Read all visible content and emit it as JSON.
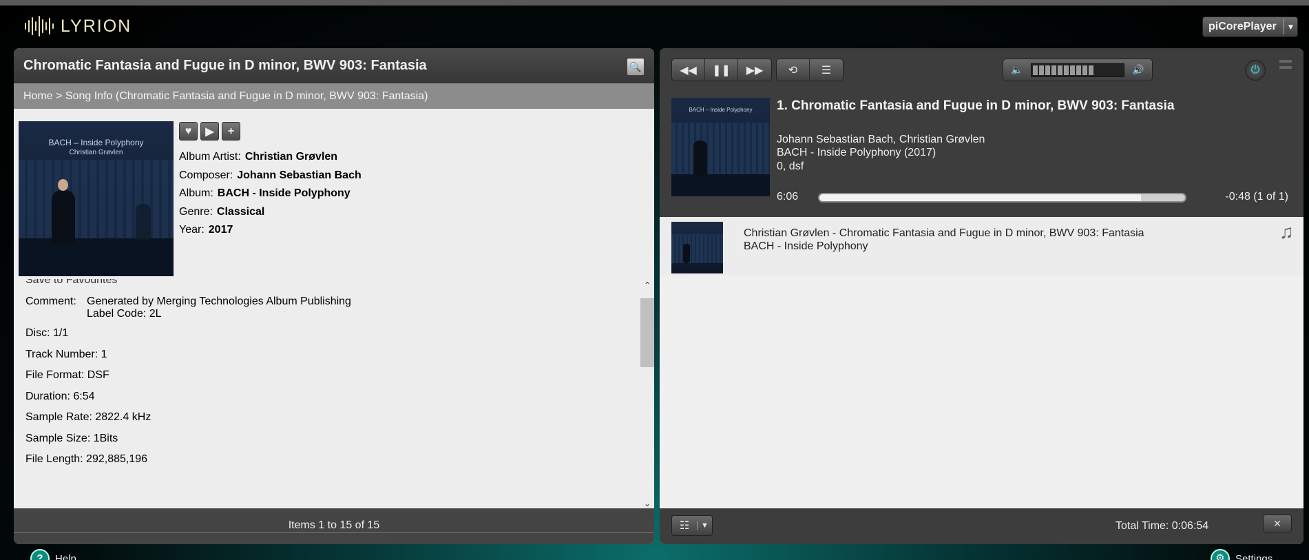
{
  "app": {
    "logo_text": "LYRION",
    "player_name": "piCorePlayer"
  },
  "left": {
    "title": "Chromatic Fantasia and Fugue in D minor, BWV 903: Fantasia",
    "breadcrumb": "Home > Song Info (Chromatic Fantasia and Fugue in D minor, BWV 903: Fantasia)",
    "cover": {
      "title": "BACH – Inside Polyphony",
      "artist": "Christian Grøvlen"
    },
    "meta": [
      {
        "label": "Album Artist:",
        "value": "Christian Grøvlen"
      },
      {
        "label": "Composer:",
        "value": "Johann Sebastian Bach"
      },
      {
        "label": "Album:",
        "value": "BACH - Inside Polyphony"
      },
      {
        "label": "Genre:",
        "value": "Classical"
      },
      {
        "label": "Year:",
        "value": "2017"
      }
    ],
    "cut_row": "Save to Favourites",
    "comment": {
      "label": "Comment:",
      "line1": "Generated by Merging Technologies Album Publishing",
      "line2": "Label Code: 2L"
    },
    "details": [
      "Disc: 1/1",
      "Track Number: 1",
      "File Format: DSF",
      "Duration: 6:54",
      "Sample Rate: 2822.4 kHz",
      "Sample Size: 1Bits",
      "File Length: 292,885,196"
    ],
    "footer": "Items 1 to 15 of 15"
  },
  "now_playing": {
    "title": "1. Chromatic Fantasia and Fugue in D minor, BWV 903: Fantasia",
    "artists": "Johann Sebastian Bach, Christian Grøvlen",
    "album": "BACH - Inside Polyphony (2017)",
    "format": "0, dsf",
    "elapsed": "6:06",
    "remaining": "-0:48  (1 of 1)",
    "progress": 0.88,
    "volume_segments": 10,
    "cover_title": "BACH – Inside Polyphony"
  },
  "playlist": {
    "items": [
      {
        "line1": "Christian Grøvlen - Chromatic Fantasia and Fugue in D minor, BWV 903: Fantasia",
        "line2": "BACH - Inside Polyphony"
      }
    ],
    "total_time": "Total Time: 0:06:54"
  },
  "bottom": {
    "help": "Help",
    "settings": "Settings"
  },
  "colors": {
    "accent": "#3ab6c4",
    "logo": "#efe9c4"
  }
}
